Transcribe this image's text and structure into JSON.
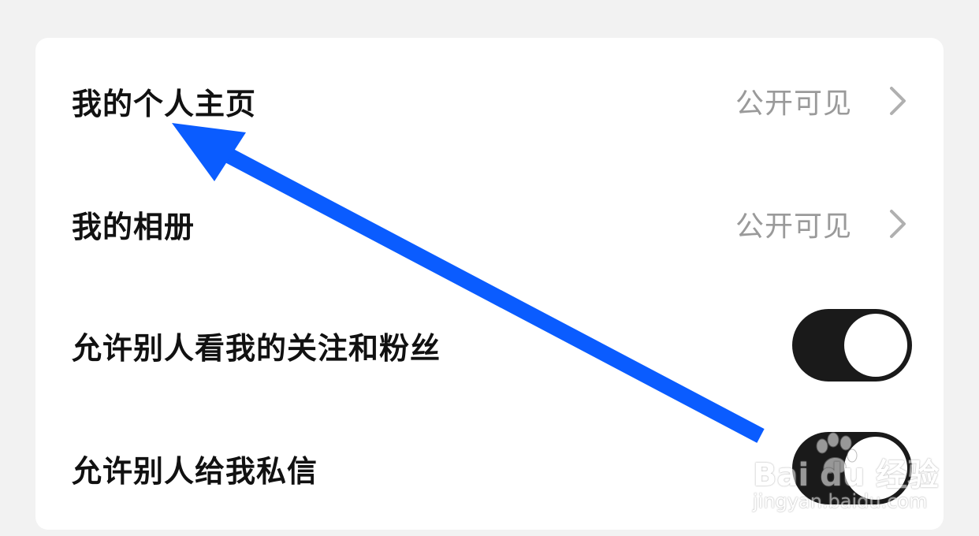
{
  "settings": {
    "rows": [
      {
        "label": "我的个人主页",
        "value": "公开可见",
        "type": "link"
      },
      {
        "label": "我的相册",
        "value": "公开可见",
        "type": "link"
      },
      {
        "label": "允许别人看我的关注和粉丝",
        "type": "toggle",
        "on": true
      },
      {
        "label": "允许别人给我私信",
        "type": "toggle",
        "on": true
      }
    ]
  },
  "watermark": {
    "brand": "Bai du 经验",
    "url": "jingyan.baidu.com"
  },
  "colors": {
    "annotation_arrow": "#0a5cff",
    "toggle_on": "#1a1a1a",
    "secondary_text": "#9a9a9a"
  },
  "icons": {
    "chevron": "chevron-right-icon",
    "arrow": "annotation-arrow-icon",
    "watermark": "paw-icon"
  }
}
